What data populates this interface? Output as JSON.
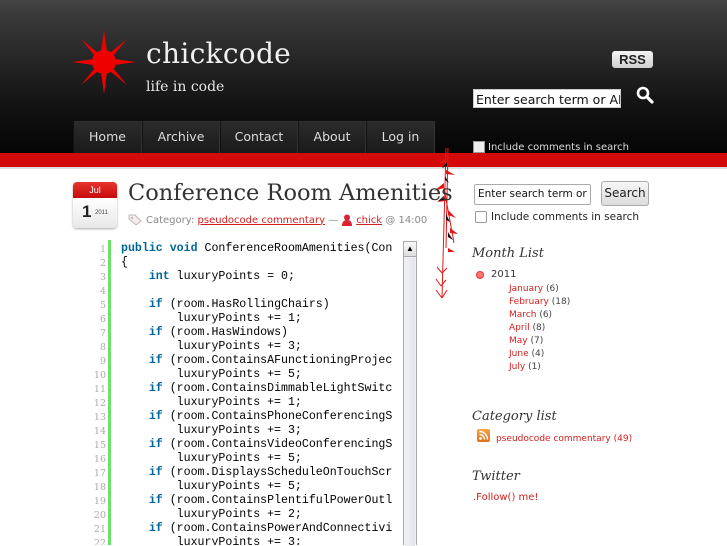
{
  "site": {
    "title": "chickcode",
    "tagline": "life in code",
    "rss_label": "RSS"
  },
  "header_search": {
    "placeholder": "Enter search term or APML url",
    "value": "Enter search term or APM",
    "include_comments_label": "Include comments in search"
  },
  "nav": {
    "items": [
      {
        "label": "Home"
      },
      {
        "label": "Archive"
      },
      {
        "label": "Contact"
      },
      {
        "label": "About"
      },
      {
        "label": "Log in"
      }
    ]
  },
  "post": {
    "date": {
      "month": "Jul",
      "day": "1",
      "year": "2011"
    },
    "title": "Conference Room Amenities",
    "meta": {
      "category_prefix": "Category:",
      "category": "pseudocode commentary",
      "separator": "—",
      "author": "chick",
      "time": "@ 14:00"
    },
    "code_lines": [
      {
        "n": "1",
        "kw": "public void",
        "rest": " ConferenceRoomAmenities(Con"
      },
      {
        "n": "2",
        "kw": "",
        "rest": "{"
      },
      {
        "n": "3",
        "kw": "    int",
        "rest": " luxuryPoints = 0;"
      },
      {
        "n": "4",
        "kw": "",
        "rest": ""
      },
      {
        "n": "5",
        "kw": "    if",
        "rest": " (room.HasRollingChairs)"
      },
      {
        "n": "6",
        "kw": "",
        "rest": "        luxuryPoints += 1;"
      },
      {
        "n": "7",
        "kw": "    if",
        "rest": " (room.HasWindows)"
      },
      {
        "n": "8",
        "kw": "",
        "rest": "        luxuryPoints += 3;"
      },
      {
        "n": "9",
        "kw": "    if",
        "rest": " (room.ContainsAFunctioningProjec"
      },
      {
        "n": "10",
        "kw": "",
        "rest": "        luxuryPoints += 5;"
      },
      {
        "n": "11",
        "kw": "    if",
        "rest": " (room.ContainsDimmableLightSwitc"
      },
      {
        "n": "12",
        "kw": "",
        "rest": "        luxuryPoints += 1;"
      },
      {
        "n": "13",
        "kw": "    if",
        "rest": " (room.ContainsPhoneConferencingS"
      },
      {
        "n": "14",
        "kw": "",
        "rest": "        luxuryPoints += 3;"
      },
      {
        "n": "15",
        "kw": "    if",
        "rest": " (room.ContainsVideoConferencingS"
      },
      {
        "n": "16",
        "kw": "",
        "rest": "        luxuryPoints += 5;"
      },
      {
        "n": "17",
        "kw": "    if",
        "rest": " (room.DisplaysScheduleOnTouchScr"
      },
      {
        "n": "18",
        "kw": "",
        "rest": "        luxuryPoints += 5;"
      },
      {
        "n": "19",
        "kw": "    if",
        "rest": " (room.ContainsPlentifulPowerOutl"
      },
      {
        "n": "20",
        "kw": "",
        "rest": "        luxuryPoints += 2;"
      },
      {
        "n": "21",
        "kw": "    if",
        "rest": " (room.ContainsPowerAndConnectivi"
      },
      {
        "n": "22",
        "kw": "",
        "rest": "        luxuryPoints += 3;"
      }
    ]
  },
  "sidebar": {
    "search": {
      "value": "Enter search term or APML url",
      "button": "Search",
      "include_comments_label": "Include comments in search"
    },
    "month_list": {
      "heading": "Month List",
      "year": "2011",
      "months": [
        {
          "name": "January",
          "count": "(6)"
        },
        {
          "name": "February",
          "count": "(18)"
        },
        {
          "name": "March",
          "count": "(6)"
        },
        {
          "name": "April",
          "count": "(8)"
        },
        {
          "name": "May",
          "count": "(7)"
        },
        {
          "name": "June",
          "count": "(4)"
        },
        {
          "name": "July",
          "count": "(1)"
        }
      ]
    },
    "category_list": {
      "heading": "Category list",
      "items": [
        {
          "name": "pseudocode commentary",
          "count": "(49)"
        }
      ]
    },
    "twitter": {
      "heading": "Twitter",
      "link": ".Follow() me!"
    }
  },
  "colors": {
    "accent_red": "#d40a0a",
    "link_red": "#d21e1e",
    "code_keyword": "#006699",
    "gutter_green": "#6ce26c"
  }
}
